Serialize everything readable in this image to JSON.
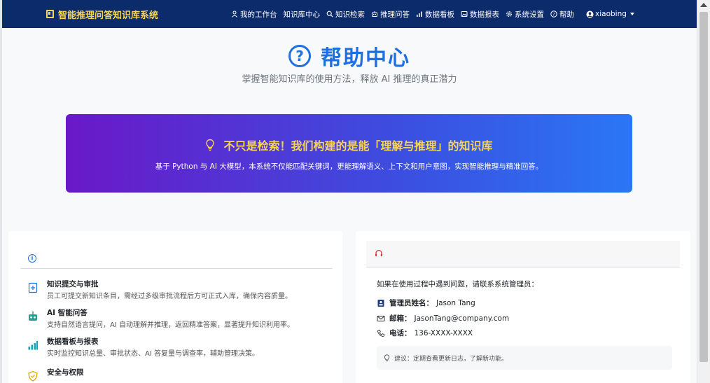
{
  "navbar": {
    "brand": "智能推理问答知识库系统",
    "items": [
      {
        "icon": "user-icon",
        "label": "我的工作台"
      },
      {
        "icon": "",
        "label": "知识库中心"
      },
      {
        "icon": "search-icon",
        "label": "知识检索"
      },
      {
        "icon": "robot-icon",
        "label": "推理问答"
      },
      {
        "icon": "bar-chart-icon",
        "label": "数据看板"
      },
      {
        "icon": "image-icon",
        "label": "数据报表"
      },
      {
        "icon": "gear-icon",
        "label": "系统设置"
      },
      {
        "icon": "question-icon",
        "label": "帮助"
      }
    ],
    "user": "xiaobing"
  },
  "hero": {
    "title": "帮助中心",
    "subtitle": "掌握智能知识库的使用方法，释放 AI 推理的真正潜力"
  },
  "banner": {
    "title": "不只是检索！我们构建的是能「理解与推理」的知识库",
    "text": "基于 Python 与 AI 大模型，本系统不仅能匹配关键词，更能理解语义、上下文和用户意图，实现智能推理与精准回答。"
  },
  "features": [
    {
      "icon": "plus-document-icon",
      "title": "知识提交与审批",
      "desc": "员工可提交新知识条目，需经过多级审批流程后方可正式入库，确保内容质量。"
    },
    {
      "icon": "robot-icon",
      "title": "AI 智能问答",
      "desc": "支持自然语言提问，AI 自动理解并推理，返回精准答案，显著提升知识利用率。"
    },
    {
      "icon": "bar-chart-icon",
      "title": "数据看板与报表",
      "desc": "实时监控知识总量、审批状态、AI 答复量与调查率，辅助管理决策。"
    },
    {
      "icon": "shield-icon",
      "title": "安全与权限",
      "desc": ""
    }
  ],
  "contact": {
    "intro": "如果在使用过程中遇到问题，请联系系统管理员：",
    "rows": [
      {
        "icon": "id-card-icon",
        "label": "管理员姓名：",
        "value": "Jason Tang"
      },
      {
        "icon": "mail-icon",
        "label": "邮箱：",
        "value": "JasonTang@company.com"
      },
      {
        "icon": "phone-icon",
        "label": "电话：",
        "value": "136-XXXX-XXXX"
      }
    ],
    "tip": "建议：定期查看更新日志，了解新功能。"
  },
  "colors": {
    "navbar": "#0c2b6b",
    "brand": "#f7d358",
    "accent": "#1e6fe0",
    "banner_start": "#6a18c8",
    "banner_end": "#2a77f5"
  }
}
